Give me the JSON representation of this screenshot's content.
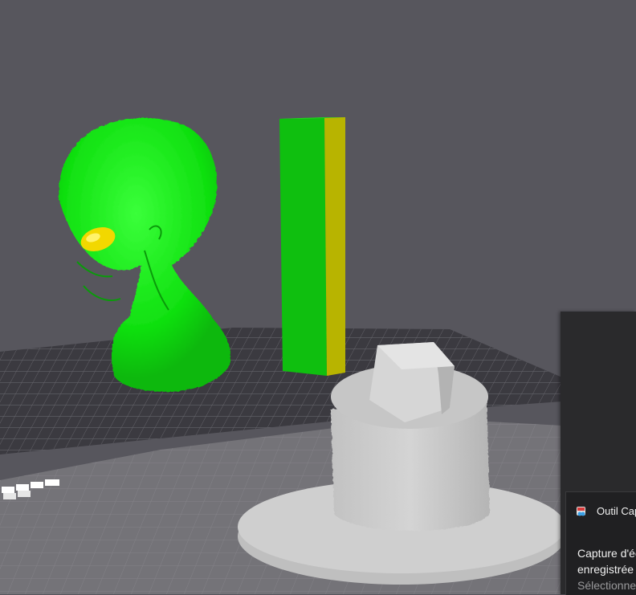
{
  "viewport": {
    "background_color": "#57565d",
    "build_plate_color": "#3b3a40",
    "grid_line_color": "#6c6b72"
  },
  "scene": {
    "objects": [
      {
        "name": "alien-bust",
        "color": "#12e612",
        "eye_color": "#f2d800"
      },
      {
        "name": "rectangular-pillar",
        "color": "#0fbf0f",
        "side_color": "#b8b400"
      },
      {
        "name": "hat-model",
        "color": "#c9c9c9"
      }
    ]
  },
  "notification": {
    "app_name": "Outil Capture d'écran",
    "app_icon": "snipping-tool-icon",
    "body_line1": "Capture d'écran copiée dans le Presse-papiers",
    "body_line2": "enregistrée automatiquement dans le dossier",
    "body_line3": "Sélectionnez ici pour annoter et partager"
  }
}
